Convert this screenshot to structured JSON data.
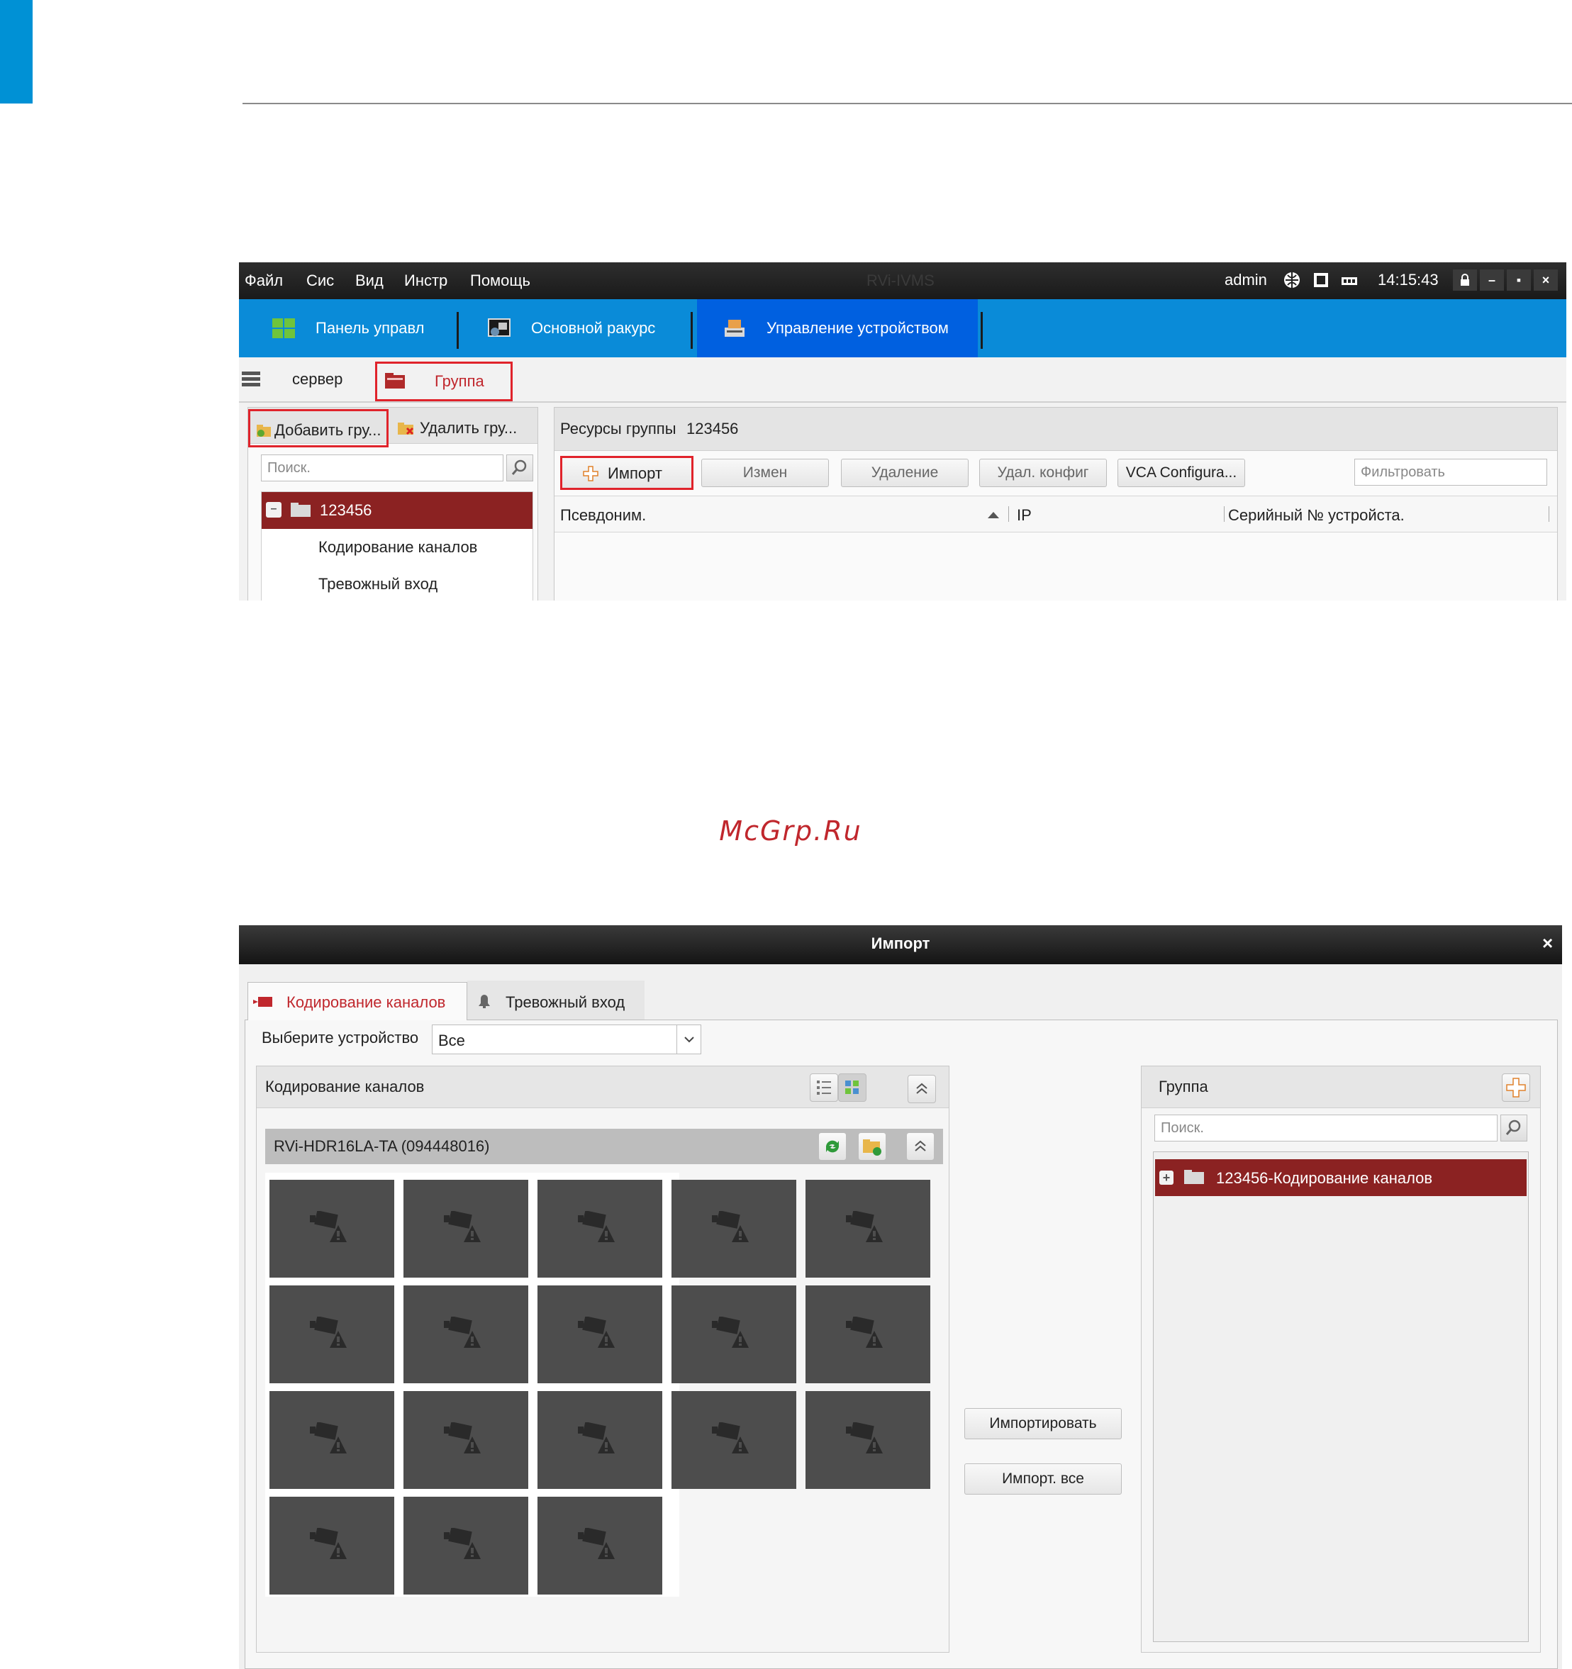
{
  "watermark": "McGrp.Ru",
  "screen1": {
    "menu": [
      "Файл",
      "Сис",
      "Вид",
      "Инстр",
      "Помощь"
    ],
    "app_title": "RVi-IVMS",
    "user": "admin",
    "time": "14:15:43",
    "tabs": [
      {
        "label": "Панель управл",
        "icon": "grid-icon"
      },
      {
        "label": "Основной ракурс",
        "icon": "camera-view-icon"
      },
      {
        "label": "Управление устройством",
        "icon": "device-management-icon",
        "active": true
      }
    ],
    "subtabs": {
      "server": "сервер",
      "group": "Группа"
    },
    "left_panel": {
      "add_group": "Добавить гру...",
      "delete_group": "Удалить гру...",
      "search_placeholder": "Поиск.",
      "tree_root": "123456",
      "tree_items": [
        "Кодирование каналов",
        "Тревожный вход"
      ]
    },
    "right_panel": {
      "title": "Ресурсы группы",
      "group_name": "123456",
      "buttons": {
        "import": "Импорт",
        "edit": "Измен",
        "delete": "Удаление",
        "remote_config": "Удал. конфиг",
        "vca": "VCA Configura..."
      },
      "filter_placeholder": "Фильтровать",
      "columns": [
        "Псевдоним.",
        "IP",
        "Серийный № устройста."
      ]
    },
    "highlight_color": "#e0232b",
    "accent_blue": "#0a8bd8"
  },
  "screen2": {
    "title": "Импорт",
    "tabs": [
      "Кодирование каналов",
      "Тревожный вход"
    ],
    "device_label": "Выберите устройство",
    "device_value": "Все",
    "channels_panel_title": "Кодирование каналов",
    "device_name": "RVi-HDR16LA-TA (094448016)",
    "tile_count": 18,
    "import_button": "Импортировать",
    "import_all_button": "Импорт. все",
    "group_panel_title": "Группа",
    "search_placeholder": "Поиск.",
    "group_item": "123456-Кодирование каналов",
    "selected_color": "#8b2222"
  }
}
